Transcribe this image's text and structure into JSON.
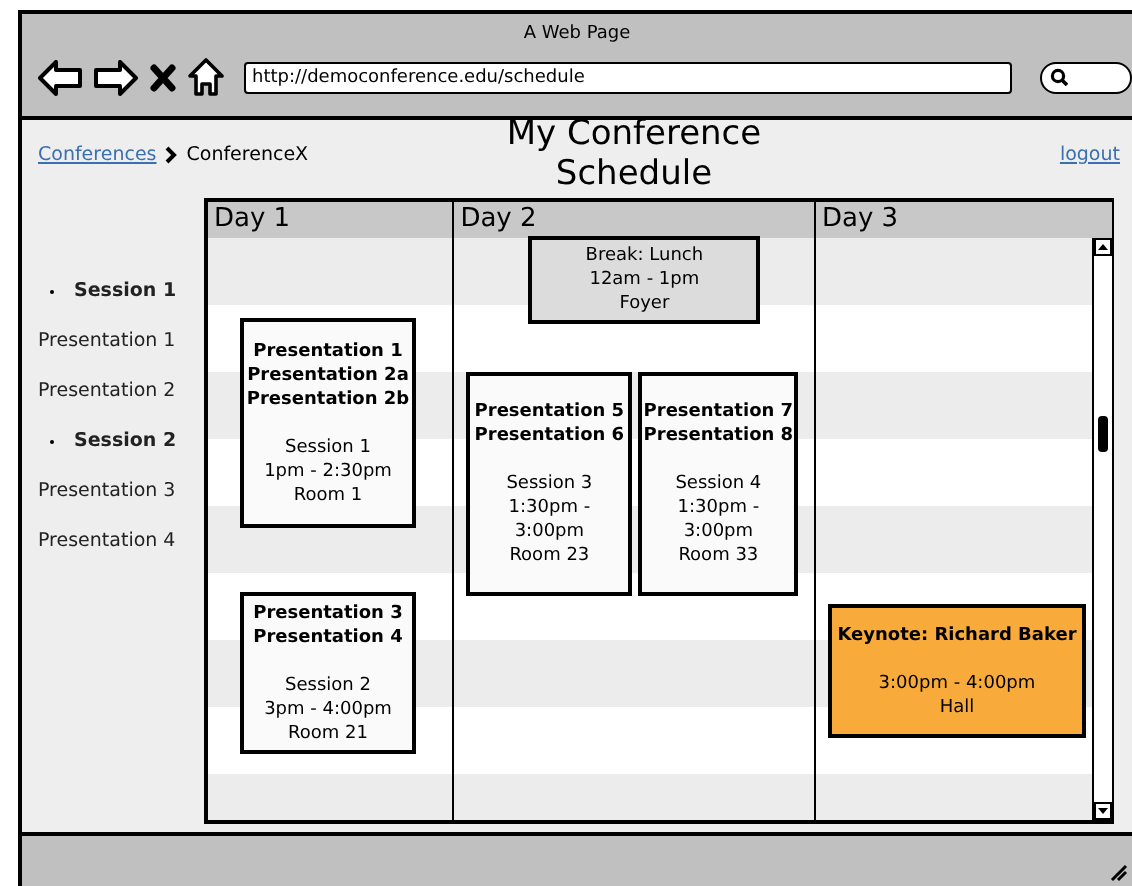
{
  "browser": {
    "title": "A Web Page",
    "url": "http://democonference.edu/schedule"
  },
  "breadcrumb": [
    {
      "label": "Conferences",
      "kind": "link"
    },
    {
      "label": "ConferenceX",
      "kind": "current"
    }
  ],
  "page_title": "My Conference Schedule",
  "logout": "logout",
  "outline": [
    {
      "label": "Session 1",
      "children": [
        {
          "label": "Presentation 1"
        },
        {
          "label": "Presentation 2"
        }
      ]
    },
    {
      "label": "Session 2",
      "children": [
        {
          "label": "Presentation 3"
        },
        {
          "label": "Presentation 4"
        }
      ]
    }
  ],
  "days": [
    {
      "label": "Day 1",
      "events": [
        {
          "kind": "session",
          "titles": [
            "Presentation 1",
            "Presentation 2a",
            "Presentation 2b"
          ],
          "details": [
            "Session 1",
            "1pm - 2:30pm",
            "Room 1"
          ]
        },
        {
          "kind": "session",
          "titles": [
            "Presentation 3",
            "Presentation 4"
          ],
          "details": [
            "Session 2",
            "3pm - 4:00pm",
            "Room 21"
          ]
        }
      ]
    },
    {
      "label": "Day 2",
      "events": [
        {
          "kind": "break",
          "details": [
            "Break: Lunch",
            "12am - 1pm",
            "Foyer"
          ]
        },
        {
          "kind": "session",
          "titles": [
            "Presentation 5",
            "Presentation 6"
          ],
          "details": [
            "Session 3",
            "1:30pm -",
            "3:00pm",
            "Room 23"
          ]
        },
        {
          "kind": "session",
          "titles": [
            "Presentation 7",
            "Presentation 8"
          ],
          "details": [
            "Session 4",
            "1:30pm -",
            "3:00pm",
            "Room 33"
          ]
        }
      ]
    },
    {
      "label": "Day 3",
      "events": [
        {
          "kind": "keynote",
          "titles": [
            "Keynote: Richard Baker"
          ],
          "details": [
            "3:00pm - 4:00pm",
            "Hall"
          ]
        }
      ]
    }
  ]
}
